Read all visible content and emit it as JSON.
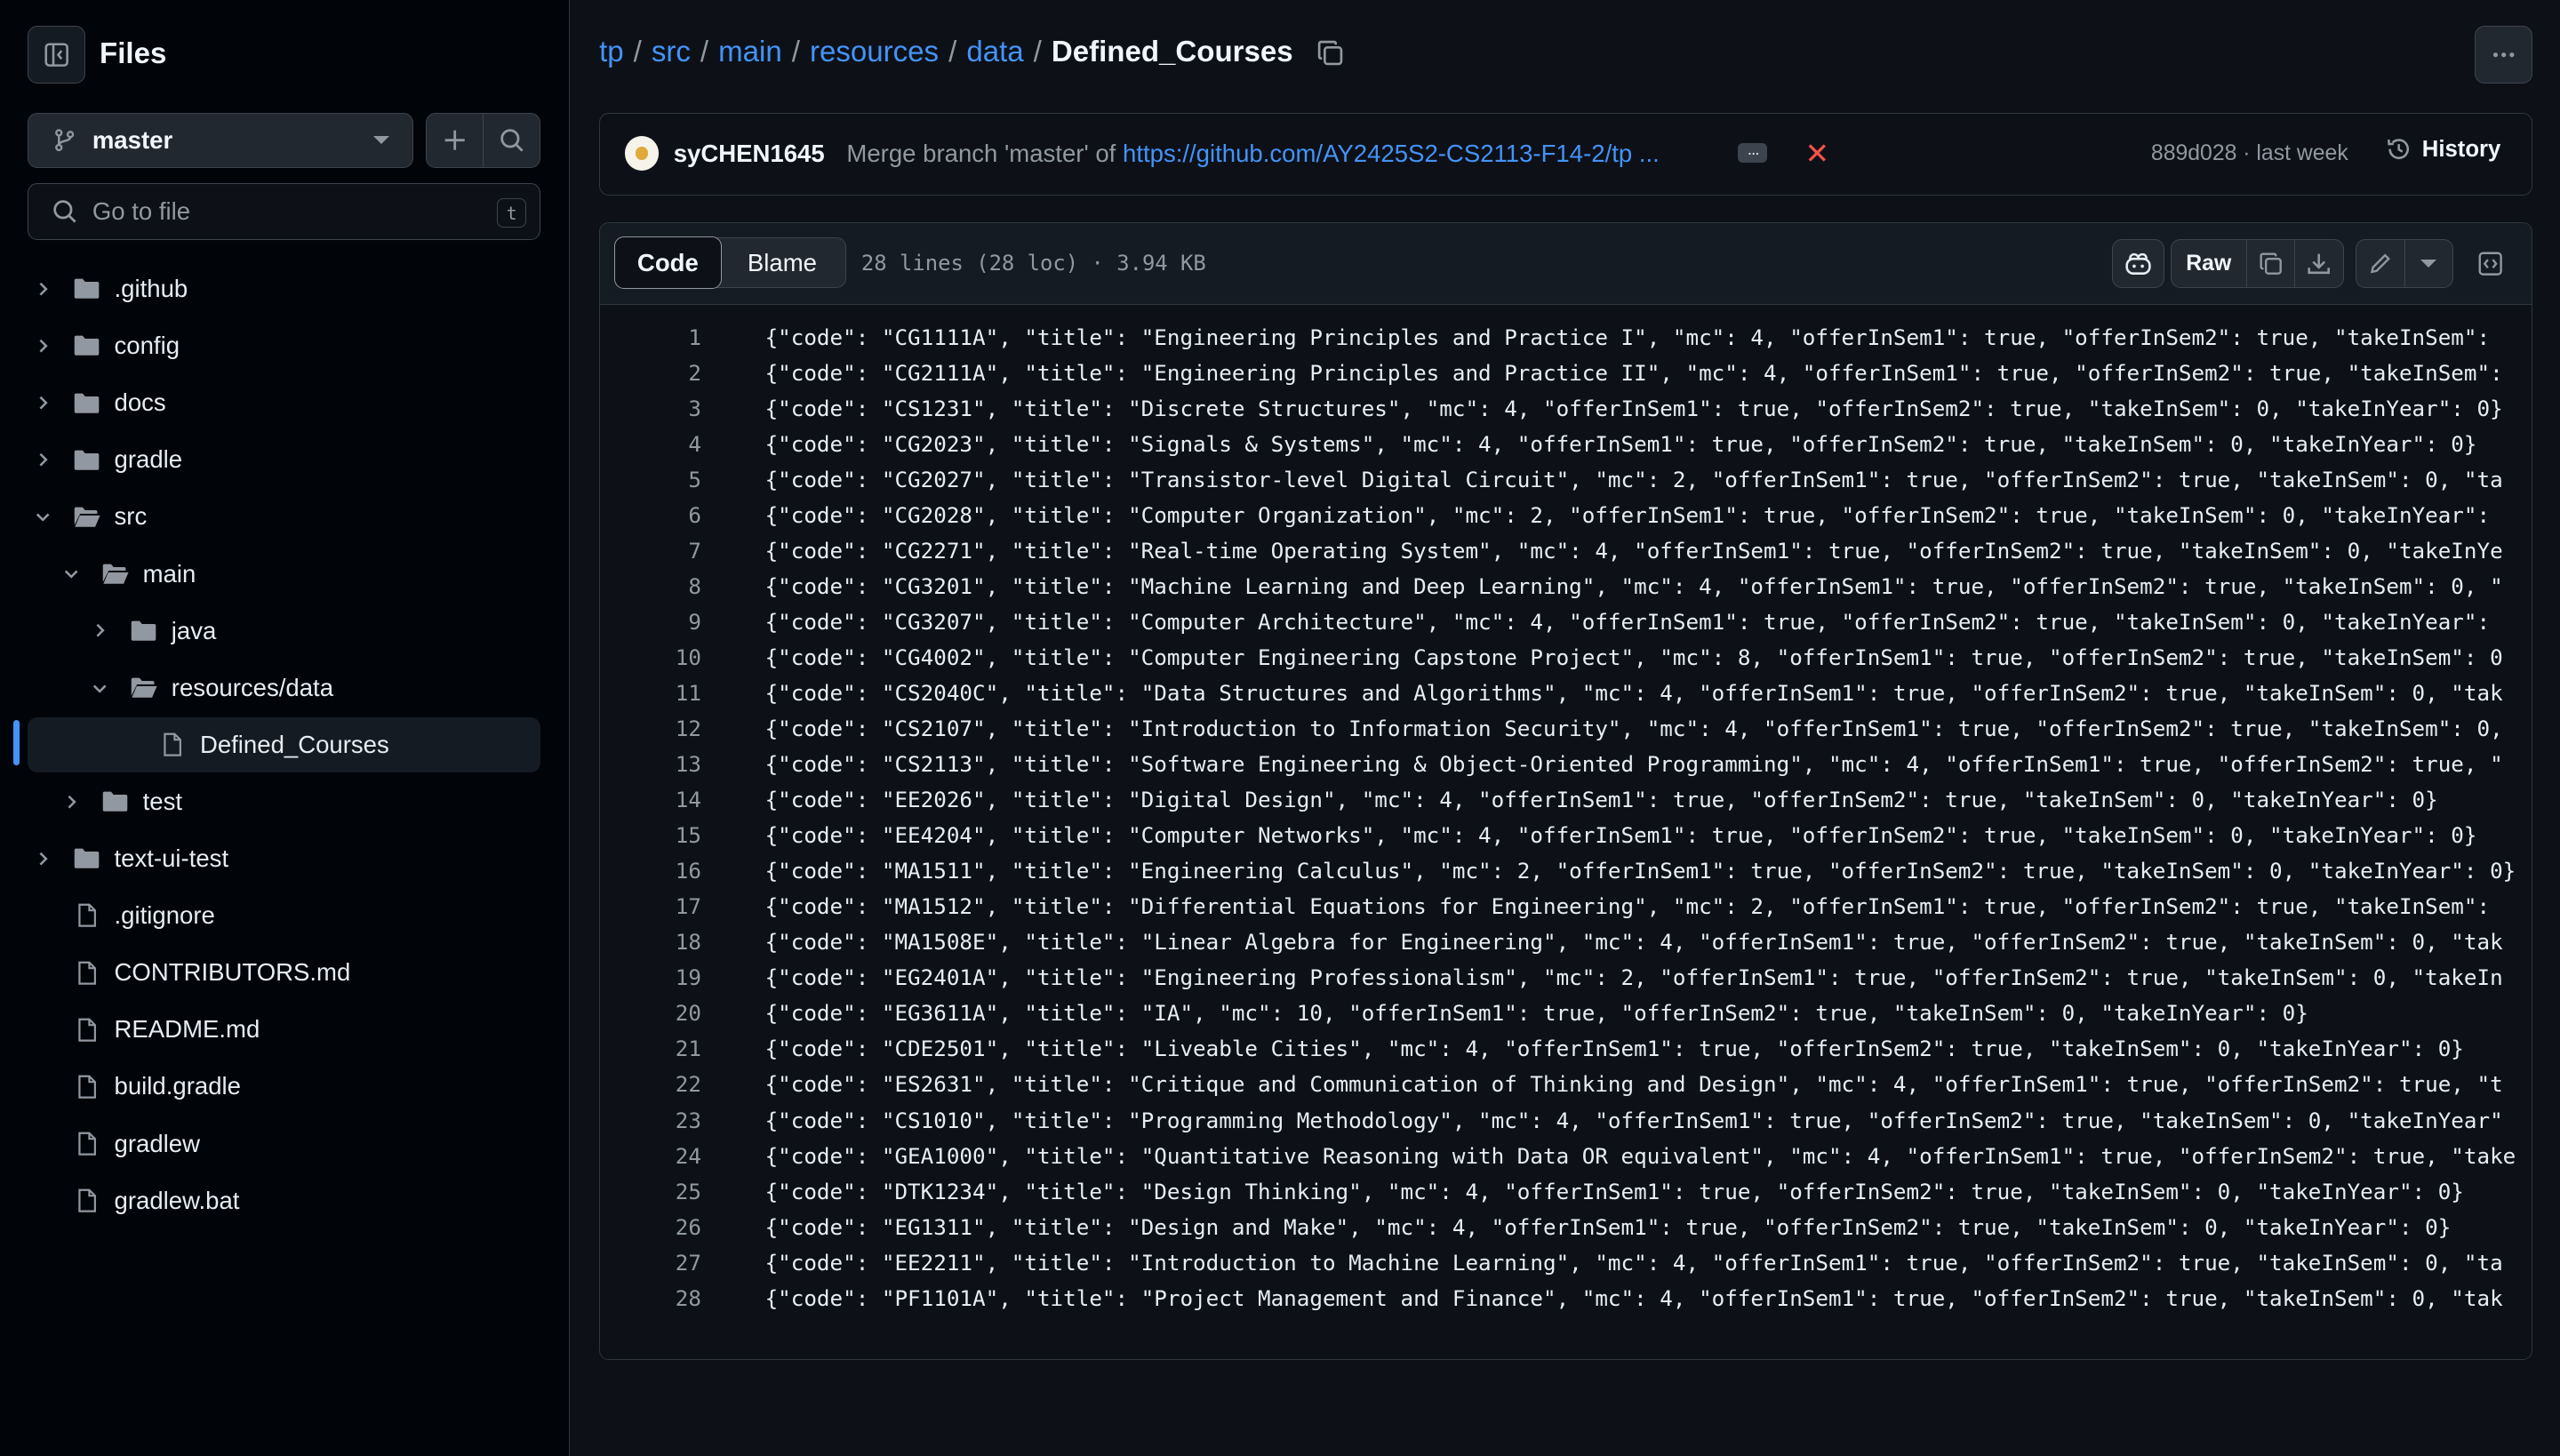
{
  "sidebar": {
    "title": "Files",
    "branch": "master",
    "goto_placeholder": "Go to file",
    "goto_shortcut": "t",
    "tree": [
      {
        "name": ".github",
        "type": "folder",
        "depth": 0,
        "expanded": false
      },
      {
        "name": "config",
        "type": "folder",
        "depth": 0,
        "expanded": false
      },
      {
        "name": "docs",
        "type": "folder",
        "depth": 0,
        "expanded": false
      },
      {
        "name": "gradle",
        "type": "folder",
        "depth": 0,
        "expanded": false
      },
      {
        "name": "src",
        "type": "folder",
        "depth": 0,
        "expanded": true
      },
      {
        "name": "main",
        "type": "folder",
        "depth": 1,
        "expanded": true
      },
      {
        "name": "java",
        "type": "folder",
        "depth": 2,
        "expanded": false
      },
      {
        "name": "resources/data",
        "type": "folder",
        "depth": 2,
        "expanded": true
      },
      {
        "name": "Defined_Courses",
        "type": "file",
        "depth": 3,
        "selected": true
      },
      {
        "name": "test",
        "type": "folder",
        "depth": 1,
        "expanded": false
      },
      {
        "name": "text-ui-test",
        "type": "folder",
        "depth": 0,
        "expanded": false
      },
      {
        "name": ".gitignore",
        "type": "file",
        "depth": 0
      },
      {
        "name": "CONTRIBUTORS.md",
        "type": "file",
        "depth": 0
      },
      {
        "name": "README.md",
        "type": "file",
        "depth": 0
      },
      {
        "name": "build.gradle",
        "type": "file",
        "depth": 0
      },
      {
        "name": "gradlew",
        "type": "file",
        "depth": 0
      },
      {
        "name": "gradlew.bat",
        "type": "file",
        "depth": 0
      }
    ]
  },
  "breadcrumb": {
    "parts": [
      "tp",
      "src",
      "main",
      "resources",
      "data"
    ],
    "separator": "/",
    "current": "Defined_Courses"
  },
  "commit": {
    "author": "syCHEN1645",
    "message_prefix": "Merge branch 'master' of ",
    "message_link": "https://github.com/AY2425S2-CS2113-F14-2/tp ...",
    "sha_time": "889d028 · last week",
    "history_label": "History"
  },
  "file": {
    "tab_code": "Code",
    "tab_blame": "Blame",
    "info": "28 lines (28 loc) · 3.94 KB",
    "raw_label": "Raw",
    "lines": [
      "{\"code\": \"CG1111A\", \"title\": \"Engineering Principles and Practice I\", \"mc\": 4, \"offerInSem1\": true, \"offerInSem2\": true, \"takeInSem\": ",
      "{\"code\": \"CG2111A\", \"title\": \"Engineering Principles and Practice II\", \"mc\": 4, \"offerInSem1\": true, \"offerInSem2\": true, \"takeInSem\":",
      "{\"code\": \"CS1231\", \"title\": \"Discrete Structures\", \"mc\": 4, \"offerInSem1\": true, \"offerInSem2\": true, \"takeInSem\": 0, \"takeInYear\": 0}",
      "{\"code\": \"CG2023\", \"title\": \"Signals & Systems\", \"mc\": 4, \"offerInSem1\": true, \"offerInSem2\": true, \"takeInSem\": 0, \"takeInYear\": 0}",
      "{\"code\": \"CG2027\", \"title\": \"Transistor-level Digital Circuit\", \"mc\": 2, \"offerInSem1\": true, \"offerInSem2\": true, \"takeInSem\": 0, \"ta",
      "{\"code\": \"CG2028\", \"title\": \"Computer Organization\", \"mc\": 2, \"offerInSem1\": true, \"offerInSem2\": true, \"takeInSem\": 0, \"takeInYear\": ",
      "{\"code\": \"CG2271\", \"title\": \"Real-time Operating System\", \"mc\": 4, \"offerInSem1\": true, \"offerInSem2\": true, \"takeInSem\": 0, \"takeInYe",
      "{\"code\": \"CG3201\", \"title\": \"Machine Learning and Deep Learning\", \"mc\": 4, \"offerInSem1\": true, \"offerInSem2\": true, \"takeInSem\": 0, \"",
      "{\"code\": \"CG3207\", \"title\": \"Computer Architecture\", \"mc\": 4, \"offerInSem1\": true, \"offerInSem2\": true, \"takeInSem\": 0, \"takeInYear\": ",
      "{\"code\": \"CG4002\", \"title\": \"Computer Engineering Capstone Project\", \"mc\": 8, \"offerInSem1\": true, \"offerInSem2\": true, \"takeInSem\": 0",
      "{\"code\": \"CS2040C\", \"title\": \"Data Structures and Algorithms\", \"mc\": 4, \"offerInSem1\": true, \"offerInSem2\": true, \"takeInSem\": 0, \"tak",
      "{\"code\": \"CS2107\", \"title\": \"Introduction to Information Security\", \"mc\": 4, \"offerInSem1\": true, \"offerInSem2\": true, \"takeInSem\": 0,",
      "{\"code\": \"CS2113\", \"title\": \"Software Engineering & Object-Oriented Programming\", \"mc\": 4, \"offerInSem1\": true, \"offerInSem2\": true, \"",
      "{\"code\": \"EE2026\", \"title\": \"Digital Design\", \"mc\": 4, \"offerInSem1\": true, \"offerInSem2\": true, \"takeInSem\": 0, \"takeInYear\": 0}",
      "{\"code\": \"EE4204\", \"title\": \"Computer Networks\", \"mc\": 4, \"offerInSem1\": true, \"offerInSem2\": true, \"takeInSem\": 0, \"takeInYear\": 0}",
      "{\"code\": \"MA1511\", \"title\": \"Engineering Calculus\", \"mc\": 2, \"offerInSem1\": true, \"offerInSem2\": true, \"takeInSem\": 0, \"takeInYear\": 0}",
      "{\"code\": \"MA1512\", \"title\": \"Differential Equations for Engineering\", \"mc\": 2, \"offerInSem1\": true, \"offerInSem2\": true, \"takeInSem\": ",
      "{\"code\": \"MA1508E\", \"title\": \"Linear Algebra for Engineering\", \"mc\": 4, \"offerInSem1\": true, \"offerInSem2\": true, \"takeInSem\": 0, \"tak",
      "{\"code\": \"EG2401A\", \"title\": \"Engineering Professionalism\", \"mc\": 2, \"offerInSem1\": true, \"offerInSem2\": true, \"takeInSem\": 0, \"takeIn",
      "{\"code\": \"EG3611A\", \"title\": \"IA\", \"mc\": 10, \"offerInSem1\": true, \"offerInSem2\": true, \"takeInSem\": 0, \"takeInYear\": 0}",
      "{\"code\": \"CDE2501\", \"title\": \"Liveable Cities\", \"mc\": 4, \"offerInSem1\": true, \"offerInSem2\": true, \"takeInSem\": 0, \"takeInYear\": 0}",
      "{\"code\": \"ES2631\", \"title\": \"Critique and Communication of Thinking and Design\", \"mc\": 4, \"offerInSem1\": true, \"offerInSem2\": true, \"t",
      "{\"code\": \"CS1010\", \"title\": \"Programming Methodology\", \"mc\": 4, \"offerInSem1\": true, \"offerInSem2\": true, \"takeInSem\": 0, \"takeInYear\"",
      "{\"code\": \"GEA1000\", \"title\": \"Quantitative Reasoning with Data OR equivalent\", \"mc\": 4, \"offerInSem1\": true, \"offerInSem2\": true, \"take",
      "{\"code\": \"DTK1234\", \"title\": \"Design Thinking\", \"mc\": 4, \"offerInSem1\": true, \"offerInSem2\": true, \"takeInSem\": 0, \"takeInYear\": 0}",
      "{\"code\": \"EG1311\", \"title\": \"Design and Make\", \"mc\": 4, \"offerInSem1\": true, \"offerInSem2\": true, \"takeInSem\": 0, \"takeInYear\": 0}",
      "{\"code\": \"EE2211\", \"title\": \"Introduction to Machine Learning\", \"mc\": 4, \"offerInSem1\": true, \"offerInSem2\": true, \"takeInSem\": 0, \"ta",
      "{\"code\": \"PF1101A\", \"title\": \"Project Management and Finance\", \"mc\": 4, \"offerInSem1\": true, \"offerInSem2\": true, \"takeInSem\": 0, \"tak"
    ]
  },
  "colors": {
    "background": "#0d1117",
    "sidebar": "#010409",
    "link": "#4493f8",
    "muted": "#9198a1",
    "text": "#e6edf3",
    "danger": "#f85149",
    "border": "#30363d"
  }
}
